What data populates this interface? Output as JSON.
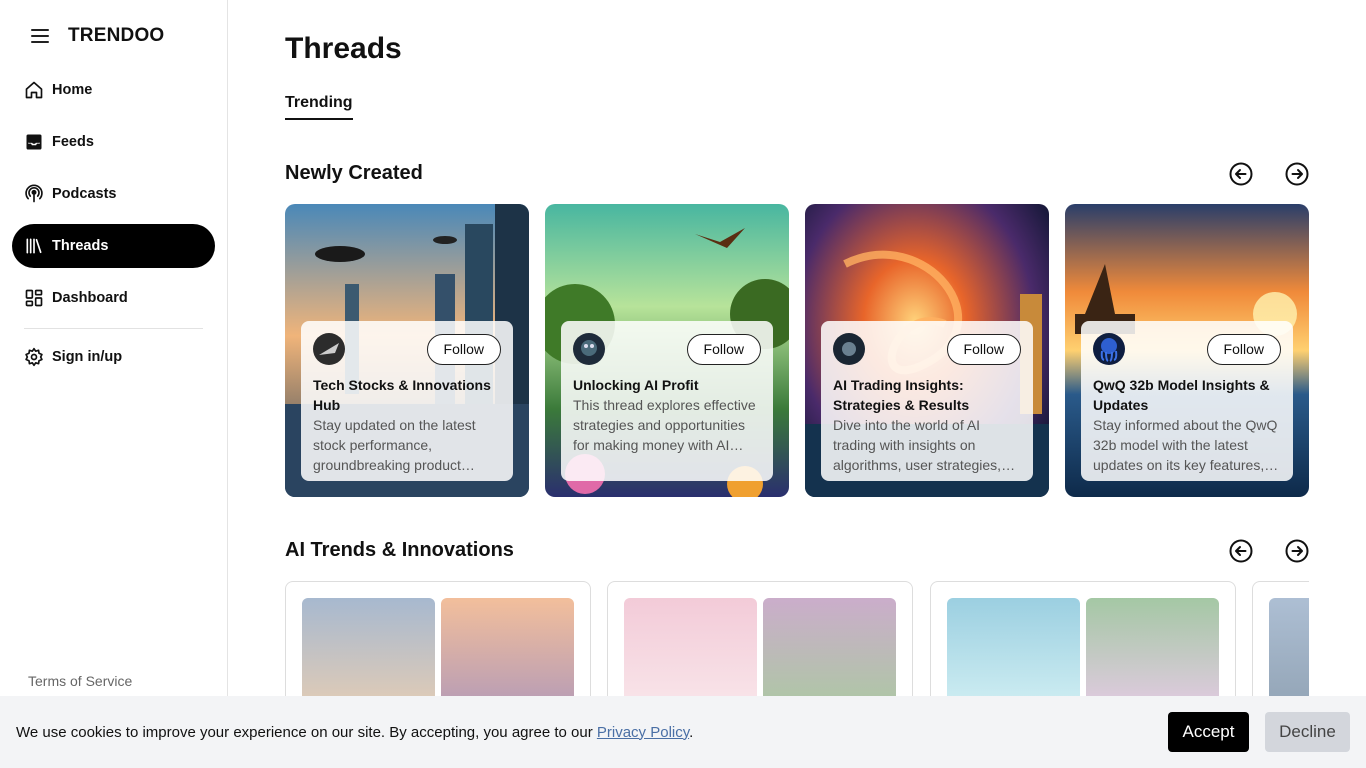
{
  "app": {
    "name": "TRENDOO"
  },
  "sidebar": {
    "items": [
      {
        "label": "Home",
        "icon": "home-icon"
      },
      {
        "label": "Feeds",
        "icon": "inbox-icon"
      },
      {
        "label": "Podcasts",
        "icon": "podcast-icon"
      },
      {
        "label": "Threads",
        "icon": "library-icon",
        "active": true
      },
      {
        "label": "Dashboard",
        "icon": "dashboard-icon"
      }
    ],
    "sign_in": "Sign in/up",
    "terms": "Terms of Service"
  },
  "main": {
    "title": "Threads",
    "tab": "Trending",
    "section1": {
      "title": "Newly Created",
      "cards": [
        {
          "title": "Tech Stocks & Innovations Hub",
          "description": "Stay updated on the latest stock performance, groundbreaking product…",
          "follow": "Follow"
        },
        {
          "title": "Unlocking AI Profit Potential",
          "description": "This thread explores effective strategies and opportunities for making money with AI…",
          "follow": "Follow"
        },
        {
          "title": "AI Trading Insights: Strategies & Results",
          "description": "Dive into the world of AI trading with insights on algorithms, user strategies,…",
          "follow": "Follow"
        },
        {
          "title": "QwQ 32b Model Insights & Updates",
          "description": "Stay informed about the QwQ 32b model with the latest updates on its key features,…",
          "follow": "Follow"
        }
      ]
    },
    "section2": {
      "title": "AI Trends & Innovations"
    }
  },
  "cookie": {
    "text": "We use cookies to improve your experience on our site. By accepting, you agree to our ",
    "link": "Privacy Policy",
    "period": ".",
    "accept": "Accept",
    "decline": "Decline"
  },
  "colors": {
    "active_bg": "#000000",
    "link": "#4a6fa5",
    "banner_bg": "#f3f4f6"
  }
}
